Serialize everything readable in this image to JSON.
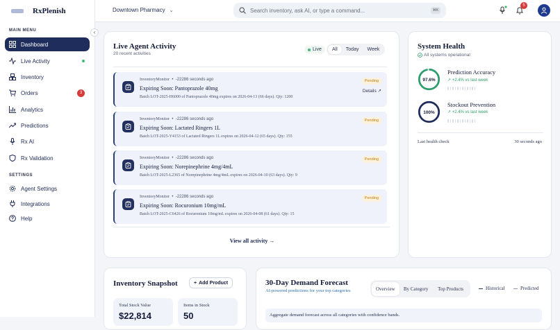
{
  "brand": {
    "name": "RxPlenish"
  },
  "sidebar": {
    "main_label": "MAIN MENU",
    "settings_label": "SETTINGS",
    "items": [
      {
        "label": "Dashboard"
      },
      {
        "label": "Live Activity"
      },
      {
        "label": "Inventory"
      },
      {
        "label": "Orders",
        "badge": "3"
      },
      {
        "label": "Analytics"
      },
      {
        "label": "Predictions"
      },
      {
        "label": "Rx AI"
      },
      {
        "label": "Rx Validation"
      }
    ],
    "settings_items": [
      {
        "label": "Agent Settings"
      },
      {
        "label": "Integrations"
      },
      {
        "label": "Help"
      }
    ]
  },
  "header": {
    "location": "Downtown Pharmacy",
    "search_placeholder": "Search inventory, ask AI, or type a command...",
    "shortcut": "⌘K",
    "notification_count": "5"
  },
  "activity": {
    "title": "Live Agent Activity",
    "subtitle": "20 recent activities",
    "live_label": "Live",
    "tabs": [
      "All",
      "Today",
      "Week"
    ],
    "items": [
      {
        "agent": "InventoryMonitor",
        "time": "-22286 seconds ago",
        "title": "Expiring Soon: Pantoprazole 40mg",
        "desc": "Batch LOT-2025-H6000 of Pantoprazole 40mg expires on 2026-04-13 (66 days). Qty: 1200",
        "status": "Pending",
        "details": "Details"
      },
      {
        "agent": "InventoryMonitor",
        "time": "-22286 seconds ago",
        "title": "Expiring Soon: Lactated Ringers 1L",
        "desc": "Batch LOT-2025-Y4153 of Lactated Ringers 1L expires on 2026-04-12 (65 days). Qty: 155",
        "status": "Pending"
      },
      {
        "agent": "InventoryMonitor",
        "time": "-22286 seconds ago",
        "title": "Expiring Soon: Norepinephrine 4mg/4mL",
        "desc": "Batch LOT-2025-L2365 of Norepinephrine 4mg/4mL expires on 2026-04-10 (63 days). Qty: 9",
        "status": "Pending"
      },
      {
        "agent": "InventoryMonitor",
        "time": "-22286 seconds ago",
        "title": "Expiring Soon: Rocuronium 10mg/mL",
        "desc": "Batch LOT-2025-C6426 of Rocuronium 10mg/mL expires on 2026-04-08 (61 days). Qty: 15",
        "status": "Pending"
      }
    ],
    "view_all": "View all activity →"
  },
  "health": {
    "title": "System Health",
    "status": "All systems operational",
    "metrics": [
      {
        "value": "97.6%",
        "label": "Prediction Accuracy",
        "change": "+2.4% vs last week",
        "level": 0.976
      },
      {
        "value": "100%",
        "label": "Stockout Prevention",
        "change": "+2.4% vs last week",
        "level": 1.0
      }
    ],
    "last_check_label": "Last health check",
    "last_check_value": "30 seconds ago"
  },
  "inventory": {
    "title": "Inventory Snapshot",
    "add_button": "Add Product",
    "stats": [
      {
        "label": "Total Stock Value",
        "value": "$22,814"
      },
      {
        "label": "Items in Stock",
        "value": "50"
      }
    ]
  },
  "forecast": {
    "title": "30-Day Demand Forecast",
    "subtitle": "AI-powered predictions for your top categories",
    "tabs": [
      "Overview",
      "By Category",
      "Top Products"
    ],
    "legend": [
      "Historical",
      "Predicted"
    ],
    "note": "Aggregate demand forecast across all categories with confidence bands."
  },
  "colors": {
    "accent": "#1f2d5c",
    "success": "#2e9e6b",
    "danger": "#d63a3a",
    "warning": "#b8801a"
  }
}
